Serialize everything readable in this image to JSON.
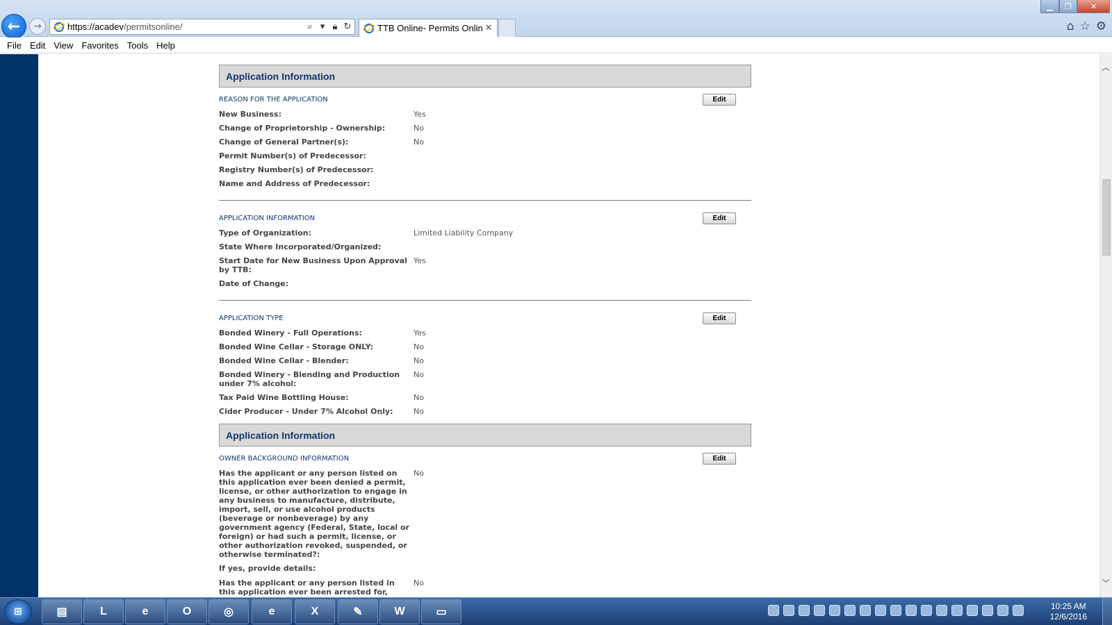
{
  "browser": {
    "url_prefix": "https://acadev",
    "url_rest": "/permitsonline/",
    "tab_title": "TTB Online- Permits Online...",
    "back_glyph": "←",
    "forward_glyph": "→",
    "close_tab_glyph": "✕",
    "icons": [
      "back-arrow-icon",
      "forward-arrow-icon",
      "ie-logo-icon",
      "search-icon",
      "lock-icon",
      "refresh-icon",
      "home-icon",
      "star-icon",
      "gear-icon"
    ]
  },
  "menu": [
    "File",
    "Edit",
    "View",
    "Favorites",
    "Tools",
    "Help"
  ],
  "sections": [
    {
      "title": "Application Information",
      "blocks": [
        {
          "title": "REASON FOR THE APPLICATION",
          "edit_label": "Edit",
          "fields": [
            {
              "label": "New Business:",
              "value": "Yes"
            },
            {
              "label": "Change of Proprietorship - Ownership:",
              "value": "No"
            },
            {
              "label": "Change of General Partner(s):",
              "value": "No"
            },
            {
              "label": "Permit Number(s) of Predecessor:",
              "value": ""
            },
            {
              "label": "Registry Number(s) of Predecessor:",
              "value": ""
            },
            {
              "label": "Name and Address of Predecessor:",
              "value": ""
            }
          ]
        },
        {
          "title": "APPLICATION INFORMATION",
          "edit_label": "Edit",
          "fields": [
            {
              "label": "Type of Organization:",
              "value": "Limited Liability Company"
            },
            {
              "label": "State Where Incorporated/Organized:",
              "value": ""
            },
            {
              "label": "Start Date for New Business Upon Approval by TTB:",
              "value": "Yes"
            },
            {
              "label": "Date of Change:",
              "value": ""
            }
          ]
        },
        {
          "title": "APPLICATION TYPE",
          "edit_label": "Edit",
          "fields": [
            {
              "label": "Bonded Winery - Full Operations:",
              "value": "Yes"
            },
            {
              "label": "Bonded Wine Cellar - Storage ONLY:",
              "value": "No"
            },
            {
              "label": "Bonded Wine Cellar - Blender:",
              "value": "No"
            },
            {
              "label": "Bonded Winery - Blending and Production under 7% alcohol:",
              "value": "No"
            },
            {
              "label": "Tax Paid Wine Bottling House:",
              "value": "No"
            },
            {
              "label": "Cider Producer - Under 7% Alcohol Only:",
              "value": "No"
            }
          ]
        }
      ]
    },
    {
      "title": "Application Information",
      "blocks": [
        {
          "title": "OWNER BACKGROUND INFORMATION",
          "edit_label": "Edit",
          "fields": [
            {
              "label": "Has the applicant or any person listed on this application ever been denied a permit, license, or other authorization to engage in any business to manufacture, distribute, import, sell, or use alcohol products (beverage or nonbeverage) by any government agency (Federal, State, local or foreign) or had such a permit, license, or other authorization revoked, suspended, or otherwise terminated?:",
              "value": "No"
            },
            {
              "label": "If yes, provide details:",
              "value": ""
            },
            {
              "label": "Has the applicant or any person listed in this application ever been arrested for, charged",
              "value": "No"
            }
          ]
        }
      ]
    }
  ],
  "taskbar": {
    "start_label": "⊞",
    "apps": [
      {
        "name": "file-explorer",
        "glyph": "▤"
      },
      {
        "name": "lync",
        "glyph": "L"
      },
      {
        "name": "internet-explorer",
        "glyph": "e"
      },
      {
        "name": "outlook",
        "glyph": "O"
      },
      {
        "name": "target-app",
        "glyph": "◎"
      },
      {
        "name": "internet-explorer-2",
        "glyph": "e"
      },
      {
        "name": "excel",
        "glyph": "X"
      },
      {
        "name": "notepad",
        "glyph": "✎"
      },
      {
        "name": "word",
        "glyph": "W"
      },
      {
        "name": "photos",
        "glyph": "▭"
      }
    ],
    "time": "10:25 AM",
    "date": "12/6/2016"
  }
}
